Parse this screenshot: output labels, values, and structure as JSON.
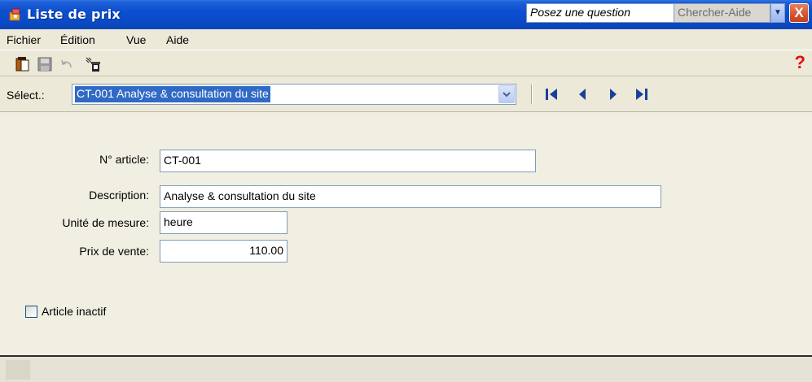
{
  "window": {
    "title": "Liste de prix",
    "ask_placeholder": "Posez une question",
    "help_search_label": "Chercher-Aide",
    "close_label": "X"
  },
  "menu": {
    "items": [
      {
        "label": "Fichier"
      },
      {
        "label": "Édition"
      },
      {
        "label": "Vue"
      },
      {
        "label": "Aide"
      }
    ]
  },
  "toolbar": {
    "icons": [
      "new-item-icon",
      "save-icon",
      "undo-icon",
      "delete-icon"
    ],
    "help_label": "?"
  },
  "selector": {
    "label": "Sélect.:",
    "value": "CT-001  Analyse & consultation du site"
  },
  "navigation": [
    "first-record-icon",
    "previous-record-icon",
    "next-record-icon",
    "last-record-icon"
  ],
  "form": {
    "item_number": {
      "label": "N° article:",
      "value": "CT-001"
    },
    "description": {
      "label": "Description:",
      "value": "Analyse & consultation du site"
    },
    "unit": {
      "label": "Unité de mesure:",
      "value": "heure"
    },
    "price": {
      "label": "Prix de vente:",
      "value": "110.00"
    },
    "inactive": {
      "label": "Article inactif",
      "checked": false
    }
  },
  "colors": {
    "titlebar": "#0b4fd0",
    "selection": "#316ac5",
    "help_red": "#e01010"
  }
}
